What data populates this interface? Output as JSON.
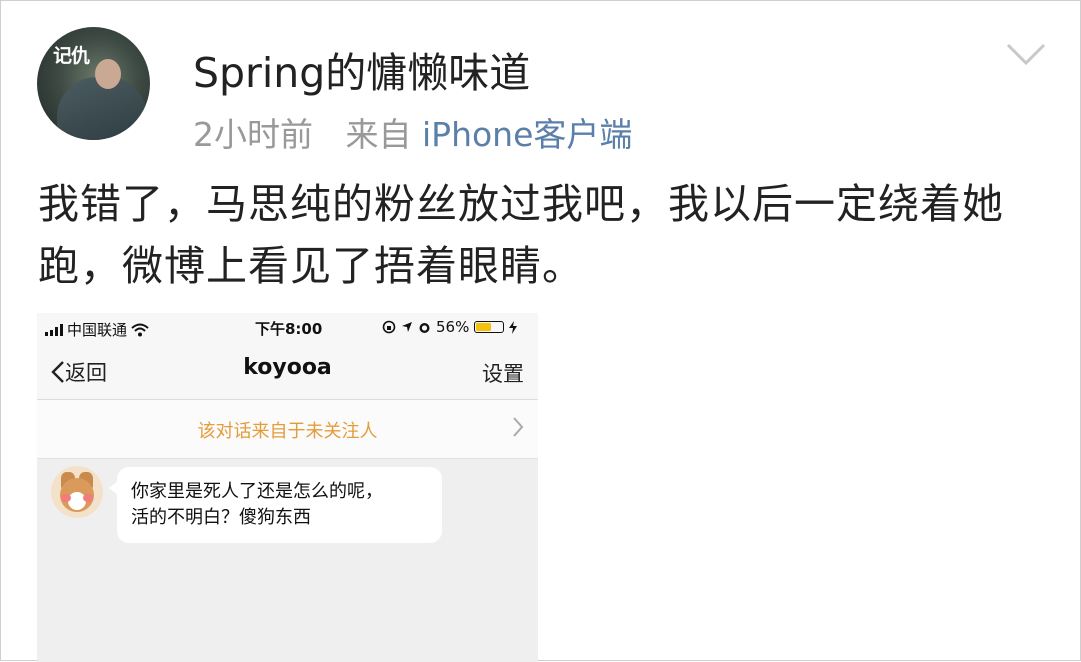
{
  "post": {
    "username": "Spring的慵懒味道",
    "time": "2小时前",
    "from_label": "来自",
    "client": "iPhone客户端",
    "avatar_tag": "记仇",
    "text": "我错了，马思纯的粉丝放过我吧，我以后一定绕着她跑，微博上看见了捂着眼睛。"
  },
  "screenshot": {
    "status_bar": {
      "carrier": "中国联通",
      "time": "下午8:00",
      "battery": "56%",
      "battery_level": 0.56
    },
    "nav": {
      "back_label": "返回",
      "title": "koyooa",
      "settings_label": "设置"
    },
    "notice": "该对话来自于未关注人",
    "message": {
      "line1": "你家里是死人了还是怎么的呢，",
      "line2": "活的不明白？傻狗东西"
    }
  },
  "colors": {
    "client_link": "#5a7fa8",
    "meta_gray": "#999999",
    "notice_orange": "#e49c3a",
    "battery_yellow": "#f4c20d"
  },
  "icons": [
    "chevron-down-icon",
    "signal-icon",
    "wifi-icon",
    "lock-rotation-icon",
    "location-icon",
    "alarm-icon",
    "battery-icon",
    "charging-icon",
    "back-chevron-icon",
    "chevron-right-icon"
  ]
}
